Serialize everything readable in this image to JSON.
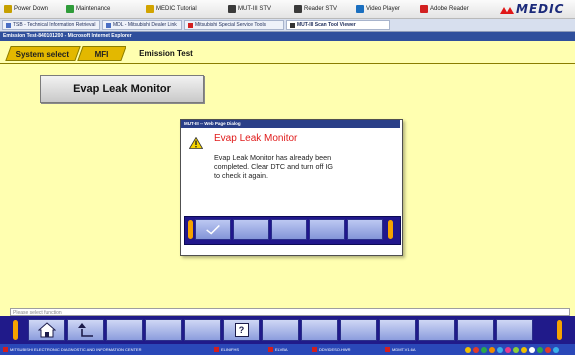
{
  "topbar": {
    "items": [
      {
        "label": "Power Down",
        "icon": "power-icon",
        "color": "#c6a000"
      },
      {
        "label": "Maintenance",
        "icon": "wrench-icon",
        "color": "#2f9c3a"
      },
      {
        "label": "MEDIC Tutorial",
        "icon": "tutorial-icon",
        "color": "#d2a400"
      },
      {
        "label": "MUT-III STV",
        "icon": "stv-icon",
        "color": "#3a3a3a"
      },
      {
        "label": "Reader STV",
        "icon": "reader-icon",
        "color": "#3a3a3a"
      },
      {
        "label": "Video Player",
        "icon": "video-icon",
        "color": "#1a6fc0"
      },
      {
        "label": "Adobe Reader",
        "icon": "adobe-icon",
        "color": "#d22020"
      }
    ],
    "logo_text": "MEDIC"
  },
  "browser_tabs": [
    {
      "label": "TSB - Technical Information Retrieval"
    },
    {
      "label": "MDL - Mitsubishi Dealer Link"
    },
    {
      "label": "Mitsubishi Special Service Tools"
    },
    {
      "label": "MUT-III Scan Tool Viewer"
    }
  ],
  "window_title": "Emission Test-840101200 - Microsoft Internet Explorer",
  "screen_tabs": {
    "system_select": "System select",
    "mfi": "MFI",
    "emission_test": "Emission Test"
  },
  "main_button": "Evap Leak Monitor",
  "dialog": {
    "title": "MUT-III -- Web Page Dialog",
    "heading": "Evap Leak Monitor",
    "message": "Evap Leak Monitor has already been\ncompleted. Clear DTC and turn off IG\nto check it again.",
    "ok_icon": "checkmark-icon"
  },
  "status_text": "Please select function",
  "function_bar": {
    "home_icon": "home-icon",
    "back_icon": "back-arrow-icon",
    "help_label": "?"
  },
  "taskbar": {
    "items": [
      "MITSUBISHI ELECTRONIC DIAGNOSTIC AND INFORMATION CENTER",
      "ELINIFHS",
      "ELVBA",
      "DDVIDESO.HWR",
      "MDMT.V1.6A"
    ]
  },
  "colors": {
    "app_background": "#ffffb0",
    "tab_active": "#e3b800",
    "dialog_heading": "#e01b1b",
    "button_bar": "#21178c",
    "end_cap": "#f6a300",
    "taskbar": "#2a48b8"
  }
}
